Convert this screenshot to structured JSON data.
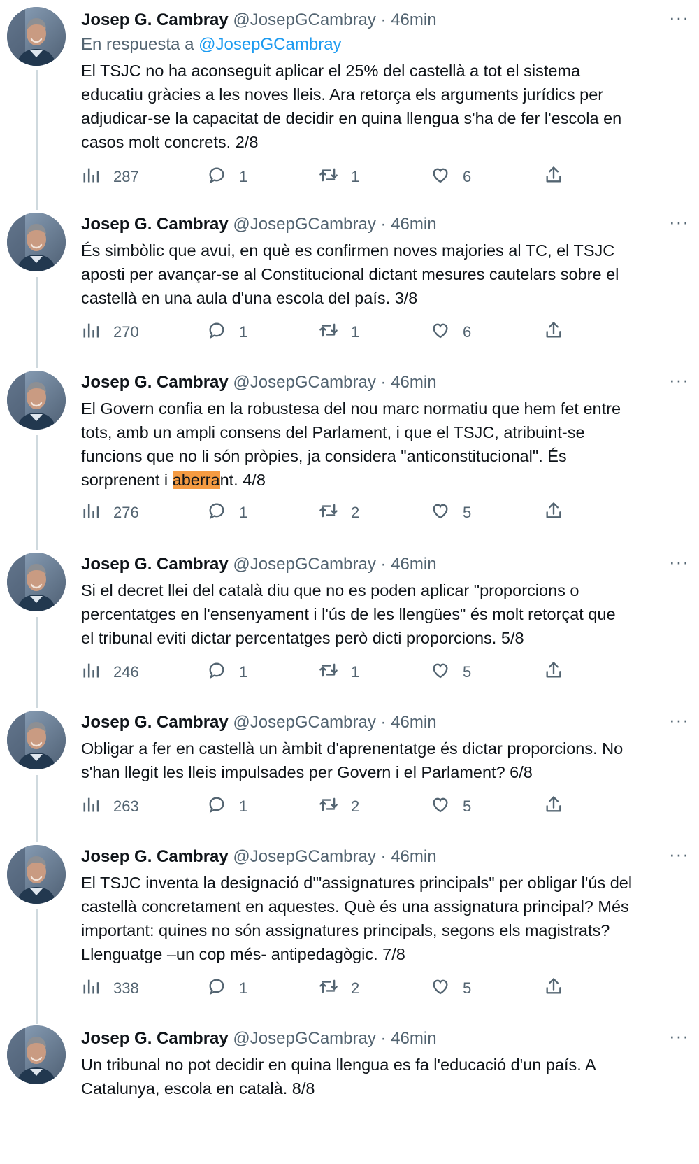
{
  "colors": {
    "text_primary": "#0f1419",
    "text_secondary": "#536471",
    "link": "#1d9bf0",
    "highlight": "#f59b42",
    "thread_line": "#cfd9de"
  },
  "icons": {
    "views": "bar-chart-icon",
    "reply": "speech-bubble-icon",
    "retweet": "retweet-icon",
    "like": "heart-icon",
    "share": "share-upload-icon",
    "more": "ellipsis-icon"
  },
  "tweets": [
    {
      "name": "Josep G. Cambray",
      "handle": "@JosepGCambray",
      "sep": "·",
      "time": "46min",
      "more": "···",
      "reply_prefix": "En respuesta a",
      "reply_handle": "@JosepGCambray",
      "text": "El TSJC no ha aconseguit aplicar el 25% del castellà a tot el sistema\neducatiu gràcies a les noves lleis. Ara retorça els arguments jurídics per\nadjudicar-se la capacitat de decidir en quina llengua s'ha de fer l'escola en\ncasos molt concrets. 2/8",
      "views": "287",
      "replies": "1",
      "retweets": "1",
      "likes": "6"
    },
    {
      "name": "Josep G. Cambray",
      "handle": "@JosepGCambray",
      "sep": "·",
      "time": "46min",
      "more": "···",
      "text": "És simbòlic que avui, en què es confirmen noves majories al TC, el TSJC\naposti per avançar-se al Constitucional dictant mesures cautelars sobre el\ncastellà en una aula d'una escola del país. 3/8",
      "views": "270",
      "replies": "1",
      "retweets": "1",
      "likes": "6"
    },
    {
      "name": "Josep G. Cambray",
      "handle": "@JosepGCambray",
      "sep": "·",
      "time": "46min",
      "more": "···",
      "text_before": "El Govern confia en la robustesa del nou marc normatiu que hem fet entre\ntots, amb un ampli consens del Parlament, i que el TSJC, atribuint-se\nfuncions que no li són pròpies, ja considera \"anticonstitucional\". És\nsorprenent i ",
      "text_highlight": "aberra",
      "text_after": "nt. 4/8",
      "views": "276",
      "replies": "1",
      "retweets": "2",
      "likes": "5"
    },
    {
      "name": "Josep G. Cambray",
      "handle": "@JosepGCambray",
      "sep": "·",
      "time": "46min",
      "more": "···",
      "text": "Si el decret llei del català diu que no es poden aplicar \"proporcions o\npercentatges en l'ensenyament i l'ús de les llengües\" és molt retorçat que\nel tribunal eviti dictar percentatges però dicti proporcions. 5/8",
      "views": "246",
      "replies": "1",
      "retweets": "1",
      "likes": "5"
    },
    {
      "name": "Josep G. Cambray",
      "handle": "@JosepGCambray",
      "sep": "·",
      "time": "46min",
      "more": "···",
      "text": "Obligar a fer en castellà un àmbit d'aprenentatge és dictar proporcions. No\ns'han llegit les lleis impulsades per Govern i el Parlament? 6/8",
      "views": "263",
      "replies": "1",
      "retweets": "2",
      "likes": "5"
    },
    {
      "name": "Josep G. Cambray",
      "handle": "@JosepGCambray",
      "sep": "·",
      "time": "46min",
      "more": "···",
      "text": "El TSJC inventa la designació d'\"assignatures principals\" per obligar l'ús del\ncastellà concretament en aquestes. Què és una assignatura principal? Més\nimportant: quines no són assignatures principals, segons els magistrats?\nLlenguatge –un cop més- antipedagògic. 7/8",
      "views": "338",
      "replies": "1",
      "retweets": "2",
      "likes": "5"
    },
    {
      "name": "Josep G. Cambray",
      "handle": "@JosepGCambray",
      "sep": "·",
      "time": "46min",
      "more": "···",
      "text": "Un tribunal no pot decidir en quina llengua es fa l'educació d'un país. A\nCatalunya, escola en català. 8/8"
    }
  ]
}
